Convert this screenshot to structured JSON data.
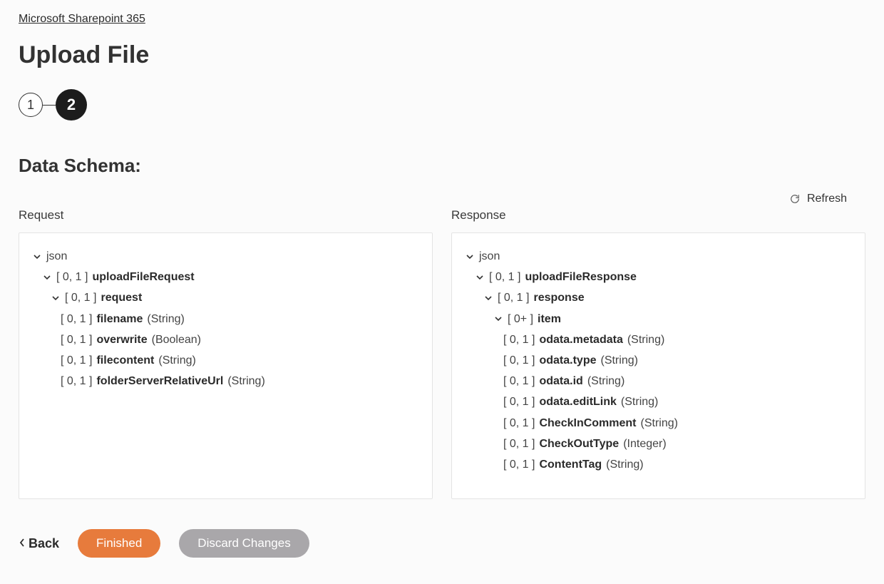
{
  "breadcrumb": {
    "label": "Microsoft Sharepoint 365"
  },
  "page": {
    "title": "Upload File"
  },
  "stepper": {
    "steps": [
      "1",
      "2"
    ],
    "active_index": 1
  },
  "section": {
    "title": "Data Schema:"
  },
  "refresh": {
    "label": "Refresh"
  },
  "request": {
    "heading": "Request",
    "root": "json",
    "tree": [
      {
        "indent": 1,
        "chevron": true,
        "card": "[ 0, 1 ]",
        "name": "uploadFileRequest",
        "type": ""
      },
      {
        "indent": 2,
        "chevron": true,
        "card": "[ 0, 1 ]",
        "name": "request",
        "type": ""
      },
      {
        "indent": 3,
        "chevron": false,
        "card": "[ 0, 1 ]",
        "name": "filename",
        "type": "(String)"
      },
      {
        "indent": 3,
        "chevron": false,
        "card": "[ 0, 1 ]",
        "name": "overwrite",
        "type": "(Boolean)"
      },
      {
        "indent": 3,
        "chevron": false,
        "card": "[ 0, 1 ]",
        "name": "filecontent",
        "type": "(String)"
      },
      {
        "indent": 3,
        "chevron": false,
        "card": "[ 0, 1 ]",
        "name": "folderServerRelativeUrl",
        "type": "(String)"
      }
    ]
  },
  "response": {
    "heading": "Response",
    "root": "json",
    "tree": [
      {
        "indent": 1,
        "chevron": true,
        "card": "[ 0, 1 ]",
        "name": "uploadFileResponse",
        "type": ""
      },
      {
        "indent": 2,
        "chevron": true,
        "card": "[ 0, 1 ]",
        "name": "response",
        "type": ""
      },
      {
        "indent": 3,
        "chevron": true,
        "card": "[ 0+ ]",
        "name": "item",
        "type": ""
      },
      {
        "indent": 4,
        "chevron": false,
        "card": "[ 0, 1 ]",
        "name": "odata.metadata",
        "type": "(String)"
      },
      {
        "indent": 4,
        "chevron": false,
        "card": "[ 0, 1 ]",
        "name": "odata.type",
        "type": "(String)"
      },
      {
        "indent": 4,
        "chevron": false,
        "card": "[ 0, 1 ]",
        "name": "odata.id",
        "type": "(String)"
      },
      {
        "indent": 4,
        "chevron": false,
        "card": "[ 0, 1 ]",
        "name": "odata.editLink",
        "type": "(String)"
      },
      {
        "indent": 4,
        "chevron": false,
        "card": "[ 0, 1 ]",
        "name": "CheckInComment",
        "type": "(String)"
      },
      {
        "indent": 4,
        "chevron": false,
        "card": "[ 0, 1 ]",
        "name": "CheckOutType",
        "type": "(Integer)"
      },
      {
        "indent": 4,
        "chevron": false,
        "card": "[ 0, 1 ]",
        "name": "ContentTag",
        "type": "(String)"
      }
    ]
  },
  "footer": {
    "back": "Back",
    "finished": "Finished",
    "discard": "Discard Changes"
  }
}
